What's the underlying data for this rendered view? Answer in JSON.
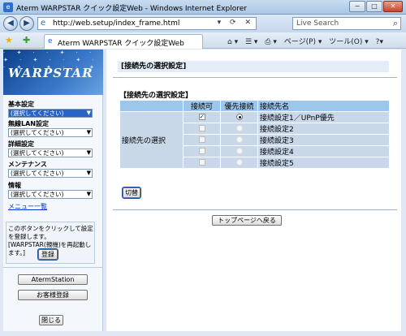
{
  "window": {
    "title": "Aterm WARPSTAR クイック設定Web - Windows Internet Explorer",
    "controls": {
      "minimize": "−",
      "maximize": "□",
      "close": "✕"
    }
  },
  "toolbar": {
    "url": "http://web.setup/index_frame.html",
    "search_placeholder": "Live Search",
    "tab_title": "Aterm WARPSTAR クイック設定Web",
    "cmd_home": "⌂ ▾",
    "cmd_feeds": "☰ ▾",
    "cmd_print": "⎙ ▾",
    "cmd_page": "ページ(P) ▾",
    "cmd_tools": "ツール(O) ▾",
    "cmd_help": "?▾"
  },
  "sidebar": {
    "logo_text": "WARPSTAR",
    "groups": [
      {
        "label": "基本設定",
        "value": "(選択してください)"
      },
      {
        "label": "無線LAN設定",
        "value": "(選択してください)"
      },
      {
        "label": "詳細設定",
        "value": "(選択してください)"
      },
      {
        "label": "メンテナンス",
        "value": "(選択してください)"
      },
      {
        "label": "情報",
        "value": "(選択してください)"
      }
    ],
    "menu_link": "メニュー一覧",
    "note": "このボタンをクリックして設定を登録します。[WARPSTAR(親機)を再起動します。]",
    "register_button": "登録",
    "aterm_station_button": "AtermStation",
    "customer_register_button": "お客様登録",
    "close_button": "閉じる"
  },
  "main": {
    "page_title": "[接続先の選択設定]",
    "section_title": "【接続先の選択設定】",
    "table": {
      "headers": [
        "接続可",
        "優先接続",
        "接続先名"
      ],
      "row_label": "接続先の選択",
      "rows": [
        {
          "name": "接続設定1／UPnP優先",
          "enabled_mark": "✓",
          "checked": true,
          "priority": true
        },
        {
          "name": "接続設定2",
          "enabled_mark": "",
          "checked": false,
          "priority": false
        },
        {
          "name": "接続設定3",
          "enabled_mark": "",
          "checked": false,
          "priority": false
        },
        {
          "name": "接続設定4",
          "enabled_mark": "",
          "checked": false,
          "priority": false
        },
        {
          "name": "接続設定5",
          "enabled_mark": "",
          "checked": false,
          "priority": false
        }
      ]
    },
    "switch_button": "切替",
    "top_page_button": "トップページへ戻る"
  }
}
